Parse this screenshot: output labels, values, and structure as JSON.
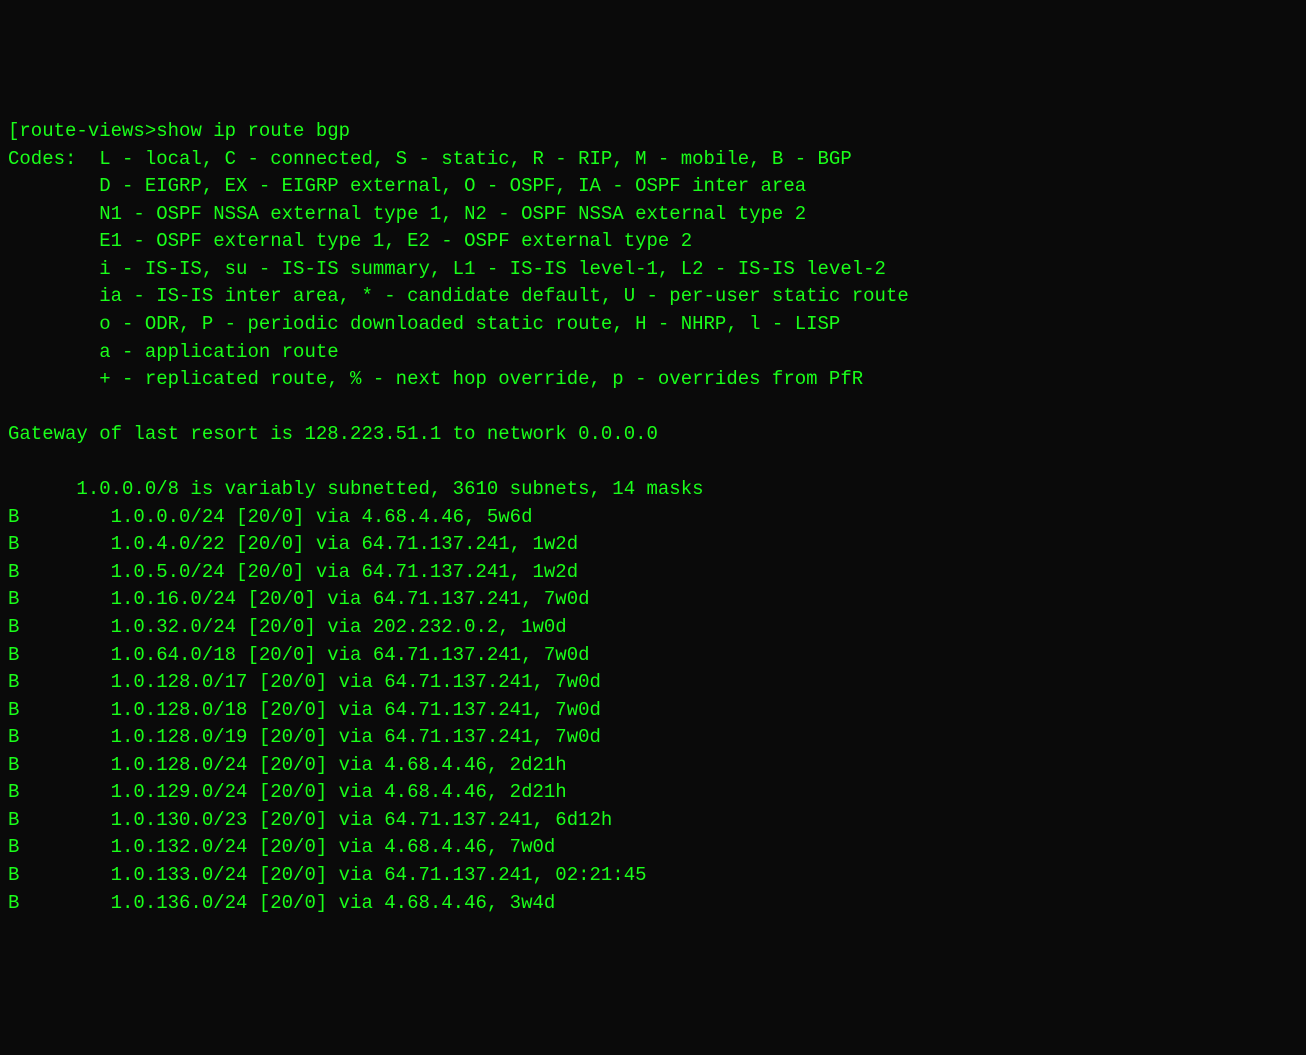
{
  "terminal": {
    "prompt_open": "[",
    "prompt": "route-views>",
    "command": "show ip route bgp",
    "codes_header": "Codes:  L - local, C - connected, S - static, R - RIP, M - mobile, B - BGP",
    "codes_line2": "        D - EIGRP, EX - EIGRP external, O - OSPF, IA - OSPF inter area",
    "codes_line3": "        N1 - OSPF NSSA external type 1, N2 - OSPF NSSA external type 2",
    "codes_line4": "        E1 - OSPF external type 1, E2 - OSPF external type 2",
    "codes_line5": "        i - IS-IS, su - IS-IS summary, L1 - IS-IS level-1, L2 - IS-IS level-2",
    "codes_line6": "        ia - IS-IS inter area, * - candidate default, U - per-user static route",
    "codes_line7": "        o - ODR, P - periodic downloaded static route, H - NHRP, l - LISP",
    "codes_line8": "        a - application route",
    "codes_line9": "        + - replicated route, % - next hop override, p - overrides from PfR",
    "blank": "",
    "gateway": "Gateway of last resort is 128.223.51.1 to network 0.0.0.0",
    "subnet_header": "      1.0.0.0/8 is variably subnetted, 3610 subnets, 14 masks",
    "routes": [
      "B        1.0.0.0/24 [20/0] via 4.68.4.46, 5w6d",
      "B        1.0.4.0/22 [20/0] via 64.71.137.241, 1w2d",
      "B        1.0.5.0/24 [20/0] via 64.71.137.241, 1w2d",
      "B        1.0.16.0/24 [20/0] via 64.71.137.241, 7w0d",
      "B        1.0.32.0/24 [20/0] via 202.232.0.2, 1w0d",
      "B        1.0.64.0/18 [20/0] via 64.71.137.241, 7w0d",
      "B        1.0.128.0/17 [20/0] via 64.71.137.241, 7w0d",
      "B        1.0.128.0/18 [20/0] via 64.71.137.241, 7w0d",
      "B        1.0.128.0/19 [20/0] via 64.71.137.241, 7w0d",
      "B        1.0.128.0/24 [20/0] via 4.68.4.46, 2d21h",
      "B        1.0.129.0/24 [20/0] via 4.68.4.46, 2d21h",
      "B        1.0.130.0/23 [20/0] via 64.71.137.241, 6d12h",
      "B        1.0.132.0/24 [20/0] via 4.68.4.46, 7w0d",
      "B        1.0.133.0/24 [20/0] via 64.71.137.241, 02:21:45",
      "B        1.0.136.0/24 [20/0] via 4.68.4.46, 3w4d"
    ]
  }
}
